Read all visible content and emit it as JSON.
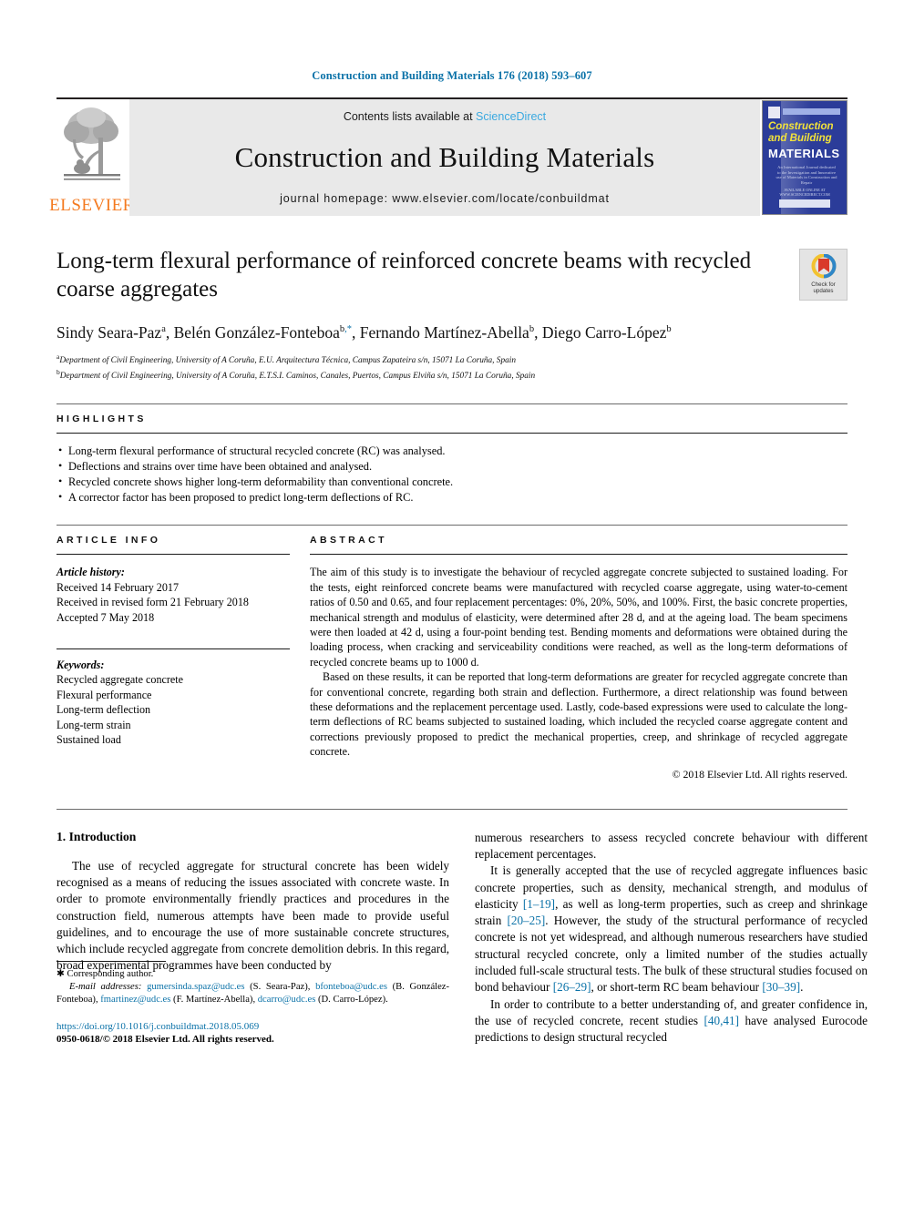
{
  "running_head": "Construction and Building Materials 176 (2018) 593–607",
  "masthead": {
    "publisher": "ELSEVIER",
    "contents_prefix": "Contents lists available at ",
    "contents_link": "ScienceDirect",
    "journal_title": "Construction and Building Materials",
    "homepage": "journal homepage: www.elsevier.com/locate/conbuildmat",
    "cover": {
      "line1": "Construction",
      "line2": "and Building",
      "line3": "MATERIALS",
      "blurb": "An International Journal dedicated to the Investigation and Innovative use of Materials in Construction and Repair",
      "footer_line": "AVAILABLE ONLINE AT WWW.SCIENCEDIRECT.COM"
    }
  },
  "article": {
    "title": "Long-term flexural performance of reinforced concrete beams with recycled coarse aggregates",
    "authors": [
      {
        "name": "Sindy Seara-Paz",
        "sup": "a",
        "mark": ""
      },
      {
        "name": "Belén González-Fonteboa",
        "sup": "b",
        "mark": ",*"
      },
      {
        "name": "Fernando Martínez-Abella",
        "sup": "b",
        "mark": ""
      },
      {
        "name": "Diego Carro-López",
        "sup": "b",
        "mark": ""
      }
    ],
    "affiliations": [
      {
        "sup": "a",
        "text": "Department of Civil Engineering, University of A Coruña, E.U. Arquitectura Técnica, Campus Zapateira s/n, 15071 La Coruña, Spain"
      },
      {
        "sup": "b",
        "text": "Department of Civil Engineering, University of A Coruña, E.T.S.I. Caminos, Canales, Puertos, Campus Elviña s/n, 15071 La Coruña, Spain"
      }
    ],
    "crossmark": {
      "line1": "Check for",
      "line2": "updates"
    }
  },
  "highlights": {
    "heading": "HIGHLIGHTS",
    "items": [
      "Long-term flexural performance of structural recycled concrete (RC) was analysed.",
      "Deflections and strains over time have been obtained and analysed.",
      "Recycled concrete shows higher long-term deformability than conventional concrete.",
      "A corrector factor has been proposed to predict long-term deflections of RC."
    ]
  },
  "article_info": {
    "heading": "ARTICLE INFO",
    "history_label": "Article history:",
    "history": [
      "Received 14 February 2017",
      "Received in revised form 21 February 2018",
      "Accepted 7 May 2018"
    ],
    "keywords_label": "Keywords:",
    "keywords": [
      "Recycled aggregate concrete",
      "Flexural performance",
      "Long-term deflection",
      "Long-term strain",
      "Sustained load"
    ]
  },
  "abstract": {
    "heading": "ABSTRACT",
    "paragraph_1": "The aim of this study is to investigate the behaviour of recycled aggregate concrete subjected to sustained loading. For the tests, eight reinforced concrete beams were manufactured with recycled coarse aggregate, using water-to-cement ratios of 0.50 and 0.65, and four replacement percentages: 0%, 20%, 50%, and 100%. First, the basic concrete properties, mechanical strength and modulus of elasticity, were determined after 28 d, and at the ageing load. The beam specimens were then loaded at 42 d, using a four-point bending test. Bending moments and deformations were obtained during the loading process, when cracking and serviceability conditions were reached, as well as the long-term deformations of recycled concrete beams up to 1000 d.",
    "paragraph_2": "Based on these results, it can be reported that long-term deformations are greater for recycled aggregate concrete than for conventional concrete, regarding both strain and deflection. Furthermore, a direct relationship was found between these deformations and the replacement percentage used. Lastly, code-based expressions were used to calculate the long-term deflections of RC beams subjected to sustained loading, which included the recycled coarse aggregate content and corrections previously proposed to predict the mechanical properties, creep, and shrinkage of recycled aggregate concrete.",
    "copyright": "© 2018 Elsevier Ltd. All rights reserved."
  },
  "body": {
    "section_title": "1. Introduction",
    "left_p1": "The use of recycled aggregate for structural concrete has been widely recognised as a means of reducing the issues associated with concrete waste. In order to promote environmentally friendly practices and procedures in the construction field, numerous attempts have been made to provide useful guidelines, and to encourage the use of more sustainable concrete structures, which include recycled aggregate from concrete demolition debris. In this regard, broad experimental programmes have been conducted by",
    "right_p1": "numerous researchers to assess recycled concrete behaviour with different replacement percentages.",
    "right_p2_a": "It is generally accepted that the use of recycled aggregate influences basic concrete properties, such as density, mechanical strength, and modulus of elasticity ",
    "right_p2_ref1": "[1–19]",
    "right_p2_b": ", as well as long-term properties, such as creep and shrinkage strain ",
    "right_p2_ref2": "[20–25]",
    "right_p2_c": ". However, the study of the structural performance of recycled concrete is not yet widespread, and although numerous researchers have studied structural recycled concrete, only a limited number of the studies actually included full-scale structural tests. The bulk of these structural studies focused on bond behaviour ",
    "right_p2_ref3": "[26–29]",
    "right_p2_d": ", or short-term RC beam behaviour ",
    "right_p2_ref4": "[30–39]",
    "right_p2_e": ".",
    "right_p3_a": "In order to contribute to a better understanding of, and greater confidence in, the use of recycled concrete, recent studies ",
    "right_p3_ref1": "[40,41]",
    "right_p3_b": " have analysed Eurocode predictions to design structural recycled"
  },
  "footnote": {
    "corresponding": "Corresponding author.",
    "email_label": "E-mail addresses:",
    "emails": [
      {
        "address": "gumersinda.spaz@udc.es",
        "owner": "(S. Seara-Paz),"
      },
      {
        "address": "bfonteboa@udc.es",
        "owner": "(B. González-Fonteboa),"
      },
      {
        "address": "fmartinez@udc.es",
        "owner": "(F. Martínez-Abella),"
      },
      {
        "address": "dcarro@udc.es",
        "owner": "(D. Carro-López)."
      }
    ],
    "doi": "https://doi.org/10.1016/j.conbuildmat.2018.05.069",
    "issn_line": "0950-0618/© 2018 Elsevier Ltd. All rights reserved."
  },
  "colors": {
    "link_blue": "#0b72a8",
    "sciencedirect_blue": "#3aa9e0",
    "elsevier_orange": "#f47a20",
    "cover_blue": "#2b3c99",
    "cover_yellow": "#f2e23a"
  }
}
